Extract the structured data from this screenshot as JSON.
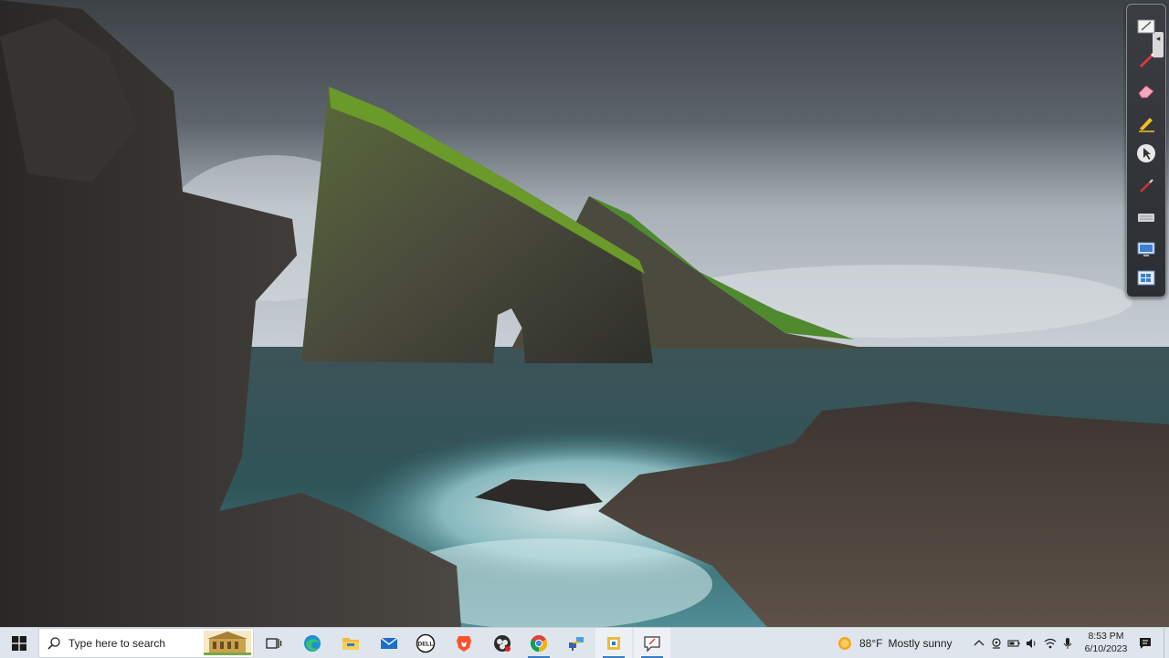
{
  "taskbar": {
    "search_placeholder": "Type here to search",
    "pinned_apps": [
      {
        "name": "Task View",
        "icon": "task-view-icon"
      },
      {
        "name": "Microsoft Edge",
        "icon": "edge-icon"
      },
      {
        "name": "File Explorer",
        "icon": "folder-icon"
      },
      {
        "name": "Mail",
        "icon": "mail-icon"
      },
      {
        "name": "Dell",
        "icon": "dell-icon"
      },
      {
        "name": "Brave",
        "icon": "brave-icon"
      },
      {
        "name": "OBS Studio",
        "icon": "obs-icon"
      },
      {
        "name": "Google Chrome",
        "icon": "chrome-icon"
      },
      {
        "name": "Network app",
        "icon": "network-app-icon"
      },
      {
        "name": "Sticky app",
        "icon": "app-icon"
      },
      {
        "name": "Screen sketch",
        "icon": "sketch-icon"
      }
    ],
    "weather": {
      "temp": "88°F",
      "condition": "Mostly sunny"
    },
    "clock": {
      "time": "8:53 PM",
      "date": "6/10/2023"
    }
  },
  "pen_toolbar": {
    "tools": [
      "whiteboard-icon",
      "pen-icon",
      "eraser-icon",
      "highlighter-icon",
      "pointer-icon",
      "brush-icon",
      "keyboard-icon",
      "screen-icon",
      "windows-icon"
    ]
  },
  "colors": {
    "accent": "#3b7cc4",
    "taskbar": "#dfe5ec",
    "toolbar": "#2f3237"
  }
}
